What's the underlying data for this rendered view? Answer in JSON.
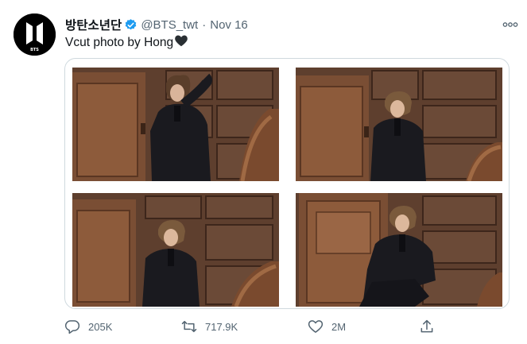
{
  "author": {
    "display_name": "방탄소년단",
    "handle": "@BTS_twt",
    "separator": "·",
    "timestamp": "Nov 16",
    "verified": true,
    "avatar_logo": "BTS"
  },
  "tweet": {
    "text": "Vcut photo by Hong",
    "emoji": "black-heart"
  },
  "media": {
    "photo_count": 4
  },
  "actions": {
    "reply_count": "205K",
    "retweet_count": "717.9K",
    "like_count": "2M"
  },
  "colors": {
    "text_primary": "#0f1419",
    "text_secondary": "#536471",
    "verified_blue": "#1d9bf0",
    "border": "#cfd9de",
    "wood": "#5a3a2a"
  },
  "icons": [
    "bts-logo-icon",
    "verified-badge-icon",
    "more-options-icon",
    "black-heart-icon",
    "reply-icon",
    "retweet-icon",
    "like-icon",
    "share-icon"
  ]
}
